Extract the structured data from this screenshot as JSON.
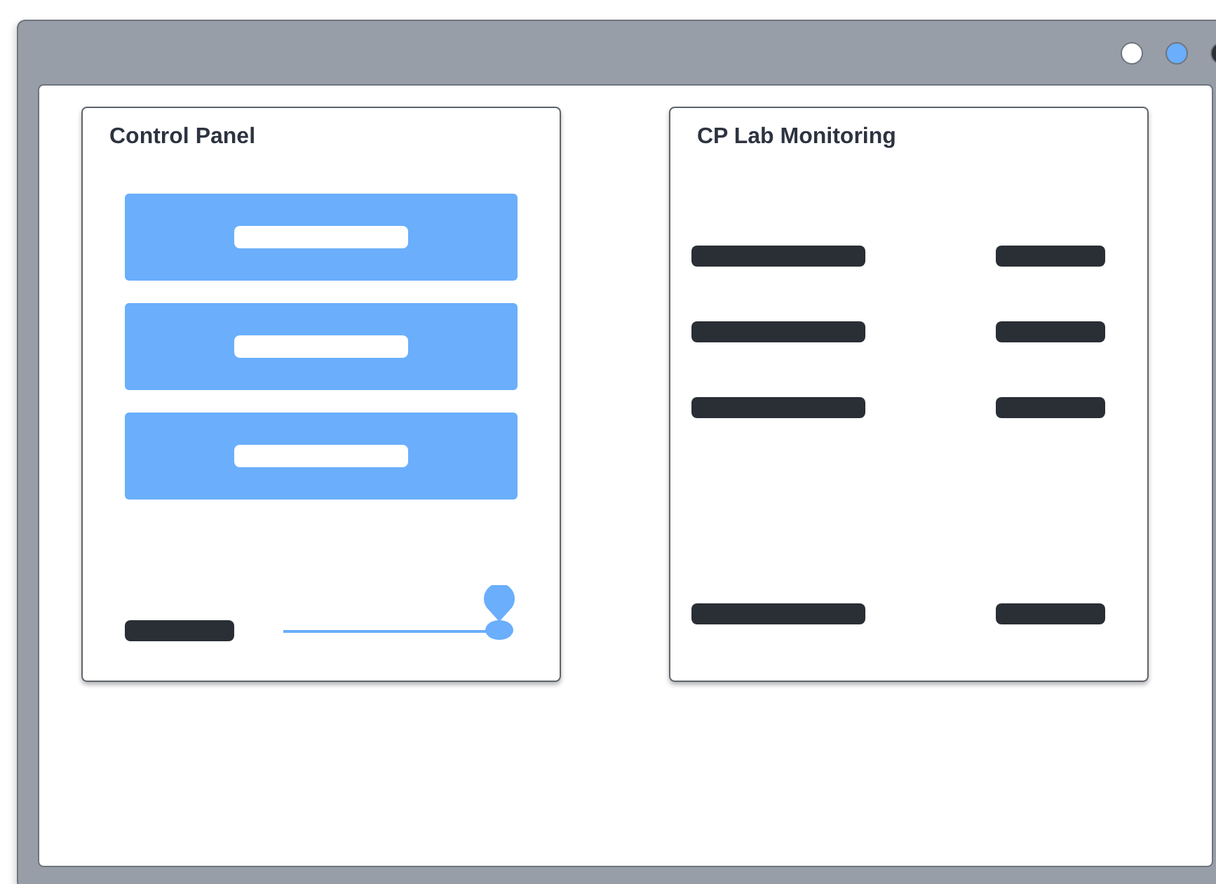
{
  "window": {
    "controls": [
      {
        "color": "#ffffff"
      },
      {
        "color": "#6aaefc"
      },
      {
        "color": "#2a2e35"
      }
    ]
  },
  "control_panel": {
    "title": "Control Panel",
    "buttons": [
      {
        "kind": "button"
      },
      {
        "kind": "button"
      },
      {
        "kind": "button"
      }
    ],
    "slider": {
      "level": 0.92
    }
  },
  "monitoring": {
    "title": "CP Lab Monitoring",
    "rows": [
      {
        "kind": "row"
      },
      {
        "kind": "row"
      },
      {
        "kind": "row"
      },
      {
        "kind": "gap"
      },
      {
        "kind": "row"
      }
    ]
  }
}
